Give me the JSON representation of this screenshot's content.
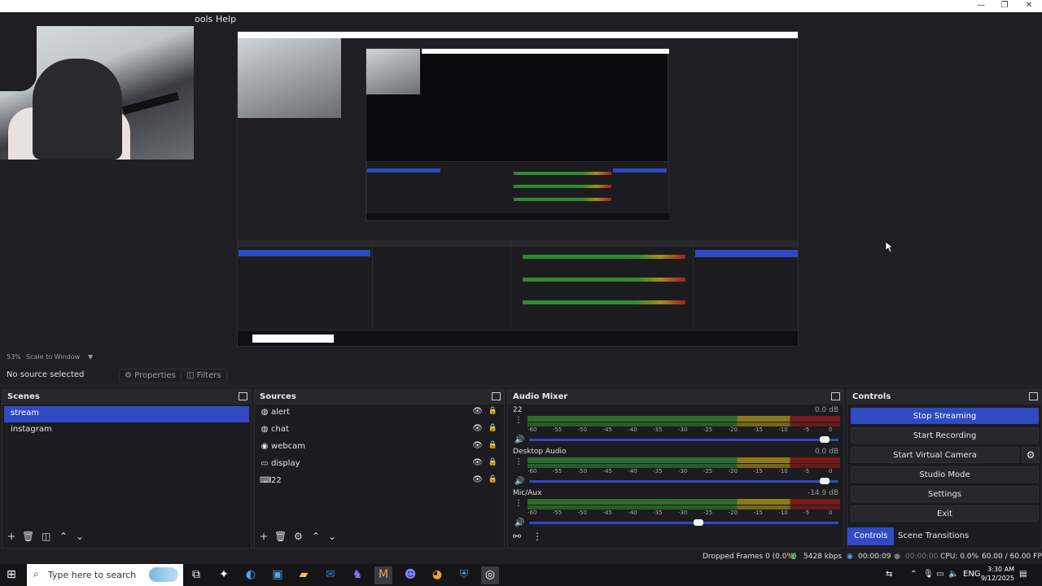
{
  "menubar": {
    "tools": "ools",
    "help": "Help"
  },
  "window_controls": {
    "minimize": "—",
    "maximize": "❐",
    "close": "✕"
  },
  "scale": {
    "zoom": "53%",
    "mode": "Scale to Window"
  },
  "source_toolbar": {
    "no_source": "No source selected",
    "properties": "Properties",
    "filters": "Filters"
  },
  "scenes": {
    "title": "Scenes",
    "items": [
      "stream",
      "instagram"
    ]
  },
  "sources": {
    "title": "Sources",
    "items": [
      "alert",
      "chat",
      "webcam",
      "display",
      "22"
    ]
  },
  "mixer": {
    "title": "Audio Mixer",
    "channels": [
      {
        "name": "22",
        "db": "0.0 dB",
        "volume": 0.97
      },
      {
        "name": "Desktop Audio",
        "db": "0.0 dB",
        "volume": 0.97
      },
      {
        "name": "Mic/Aux",
        "db": "-14.9 dB",
        "volume": 0.55
      }
    ],
    "ticks": [
      "-60",
      "-55",
      "-50",
      "-45",
      "-40",
      "-35",
      "-30",
      "-25",
      "-20",
      "-15",
      "-10",
      "-5",
      "0"
    ]
  },
  "controls": {
    "title": "Controls",
    "buttons": [
      "Stop Streaming",
      "Start Recording",
      "Start Virtual Camera",
      "Studio Mode",
      "Settings",
      "Exit"
    ],
    "tabs": [
      "Controls",
      "Scene Transitions"
    ]
  },
  "status": {
    "dropped": "Dropped Frames 0 (0.0%)",
    "kbps": "5428 kbps",
    "stream_time": "00:00:09",
    "rec_time": "00:00:00",
    "cpu": "CPU: 0.0%",
    "fps": "60.00 / 60.00 FP"
  },
  "taskbar": {
    "search_placeholder": "Type here to search",
    "lang": "ENG",
    "time": "3:30 AM",
    "date": "9/12/2025"
  },
  "colors": {
    "accent": "#2f4ac2",
    "background": "#1f1f23",
    "dock": "#1c1c20"
  }
}
